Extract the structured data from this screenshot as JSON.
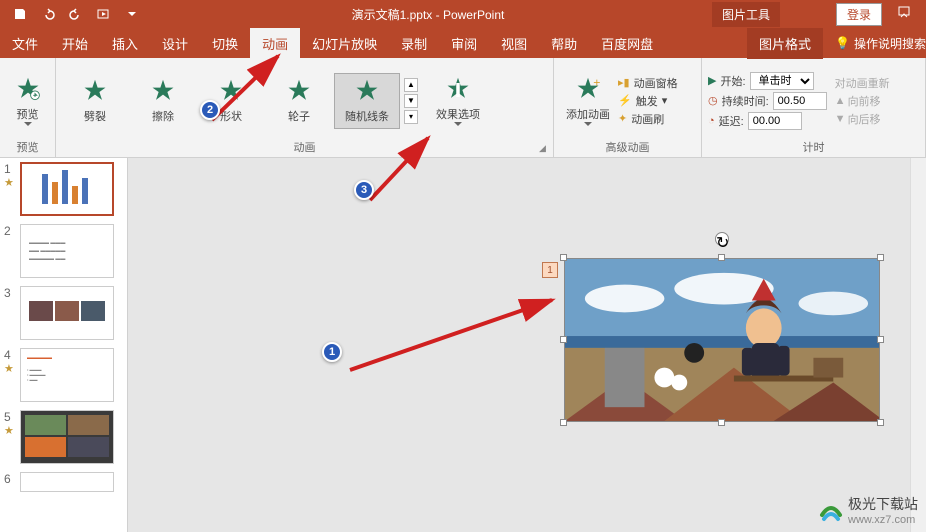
{
  "titlebar": {
    "title": "演示文稿1.pptx  -  PowerPoint",
    "tool_tab": "图片工具",
    "login": "登录"
  },
  "menu": {
    "file": "文件",
    "home": "开始",
    "insert": "插入",
    "design": "设计",
    "transitions": "切换",
    "animations": "动画",
    "slideshow": "幻灯片放映",
    "record": "录制",
    "review": "审阅",
    "view": "视图",
    "help": "帮助",
    "baidu": "百度网盘",
    "format": "图片格式",
    "tell_me": "操作说明搜索"
  },
  "ribbon": {
    "preview_group": "预览",
    "preview_btn": "预览",
    "anim_group": "动画",
    "anims": {
      "split": "劈裂",
      "wipe": "擦除",
      "shape": "形状",
      "wheel": "轮子",
      "random_bars": "随机线条"
    },
    "effect_options": "效果选项",
    "adv_group": "高级动画",
    "add_anim": "添加动画",
    "anim_pane": "动画窗格",
    "trigger": "触发",
    "anim_painter": "动画刷",
    "timing_group": "计时",
    "start_label": "开始:",
    "start_value": "单击时",
    "duration_label": "持续时间:",
    "duration_value": "00.50",
    "delay_label": "延迟:",
    "delay_value": "00.00",
    "reorder_label": "对动画重新",
    "move_earlier": "向前移",
    "move_later": "向后移"
  },
  "thumbs": {
    "s1": "1",
    "s2": "2",
    "s3": "3",
    "s4": "4",
    "s5": "5",
    "s6": "6"
  },
  "slide": {
    "anim_tag": "1"
  },
  "callouts": {
    "c1": "1",
    "c2": "2",
    "c3": "3"
  },
  "watermark": {
    "name": "极光下载站",
    "url": "www.xz7.com"
  }
}
